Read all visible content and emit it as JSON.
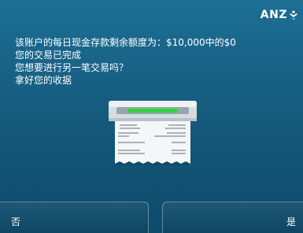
{
  "brand": {
    "name": "ANZ"
  },
  "message": {
    "lines": [
      "该账户的每日现金存款剩余额度为：$10,000中的$0",
      "您的交易已完成",
      "您想要进行另一笔交易吗？",
      "拿好您的收据"
    ]
  },
  "illustration": {
    "icon": "receipt-printer-icon"
  },
  "buttons": {
    "no_label": "否",
    "yes_label": "是"
  }
}
